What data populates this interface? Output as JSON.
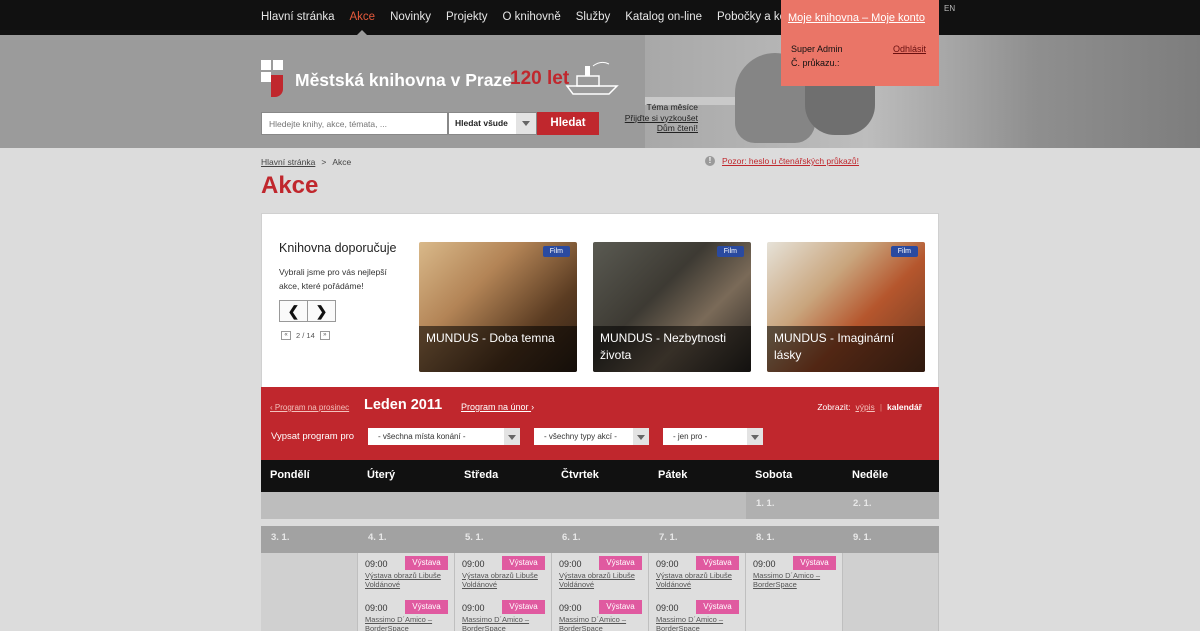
{
  "nav": {
    "items": [
      "Hlavní stránka",
      "Akce",
      "Novinky",
      "Projekty",
      "O knihovně",
      "Služby",
      "Katalog on-line",
      "Pobočky a kontakty"
    ],
    "active": "Akce",
    "lang": "EN"
  },
  "header": {
    "logo_name": "Městská knihovna v Praze",
    "logo_years": "120 let",
    "search_placeholder": "Hledejte knihy, akce, témata, ...",
    "search_scope": "Hledat všude",
    "search_button": "Hledat",
    "theme_label": "Téma měsíce",
    "theme_link1": "Přijďte si vyzkoušet",
    "theme_link2": "Dům čtení!"
  },
  "account": {
    "title": "Moje knihovna – Moje konto",
    "user": "Super Admin",
    "card": "Č. průkazu.:",
    "logout": "Odhlásit"
  },
  "breadcrumb": {
    "home": "Hlavní stránka",
    "separator": ">",
    "current": "Akce"
  },
  "alert": {
    "icon": "!",
    "text": "Pozor: heslo u čtenářských průkazů!"
  },
  "page_title": "Akce",
  "recommend": {
    "title": "Knihovna doporučuje",
    "desc": "Vybrali jsme pro vás nejlepší akce, které pořádáme!",
    "prev": "❮",
    "next": "❯",
    "first": "«",
    "last": "»",
    "page": "2 / 14",
    "cards": [
      {
        "badge": "Film",
        "caption": "MUNDUS - Doba temna"
      },
      {
        "badge": "Film",
        "caption": "MUNDUS - Nezbytnosti života"
      },
      {
        "badge": "Film",
        "caption": "MUNDUS - Imaginární lásky"
      }
    ]
  },
  "calendar": {
    "prev_link": "‹  Program na prosinec",
    "month": "Leden 2011",
    "next_link": "Program na únor",
    "next_arrow": "›",
    "view_label": "Zobrazit:",
    "view_list": "výpis",
    "view_sep": "|",
    "view_calendar": "kalendář",
    "filter_label": "Vypsat program pro",
    "filter_place": "- všechna místa konání -",
    "filter_type": "- všechny typy akcí -",
    "filter_audience": "- jen pro -",
    "days": [
      "Pondělí",
      "Úterý",
      "Středa",
      "Čtvrtek",
      "Pátek",
      "Sobota",
      "Neděle"
    ],
    "week1_dates": [
      "",
      "",
      "",
      "",
      "",
      "1. 1.",
      "2. 1."
    ],
    "week2_dates": [
      "3. 1.",
      "4. 1.",
      "5. 1.",
      "6. 1.",
      "7. 1.",
      "8. 1.",
      "9. 1."
    ],
    "events": {
      "tue": [
        {
          "time": "09:00",
          "tag": "Výstava",
          "title": "Výstava obrazů Libuše Voldánové"
        },
        {
          "time": "09:00",
          "tag": "Výstava",
          "title": "Massimo D´Amico – BorderSpace"
        }
      ],
      "wed": [
        {
          "time": "09:00",
          "tag": "Výstava",
          "title": "Výstava obrazů Libuše Voldánové"
        },
        {
          "time": "09:00",
          "tag": "Výstava",
          "title": "Massimo D´Amico – BorderSpace"
        }
      ],
      "thu": [
        {
          "time": "09:00",
          "tag": "Výstava",
          "title": "Výstava obrazů Libuše Voldánové"
        },
        {
          "time": "09:00",
          "tag": "Výstava",
          "title": "Massimo D´Amico – BorderSpace"
        }
      ],
      "fri": [
        {
          "time": "09:00",
          "tag": "Výstava",
          "title": "Výstava obrazů Libuše Voldánové"
        },
        {
          "time": "09:00",
          "tag": "Výstava",
          "title": "Massimo D´Amico – BorderSpace"
        }
      ],
      "sat": [
        {
          "time": "09:00",
          "tag": "Výstava",
          "title": "Massimo D´Amico – BorderSpace"
        }
      ]
    }
  },
  "colors": {
    "brand_red": "#c0272d",
    "account_bg": "#ea7567",
    "badge_blue": "#2a4aa0",
    "tag_pink": "#e05aa0"
  }
}
